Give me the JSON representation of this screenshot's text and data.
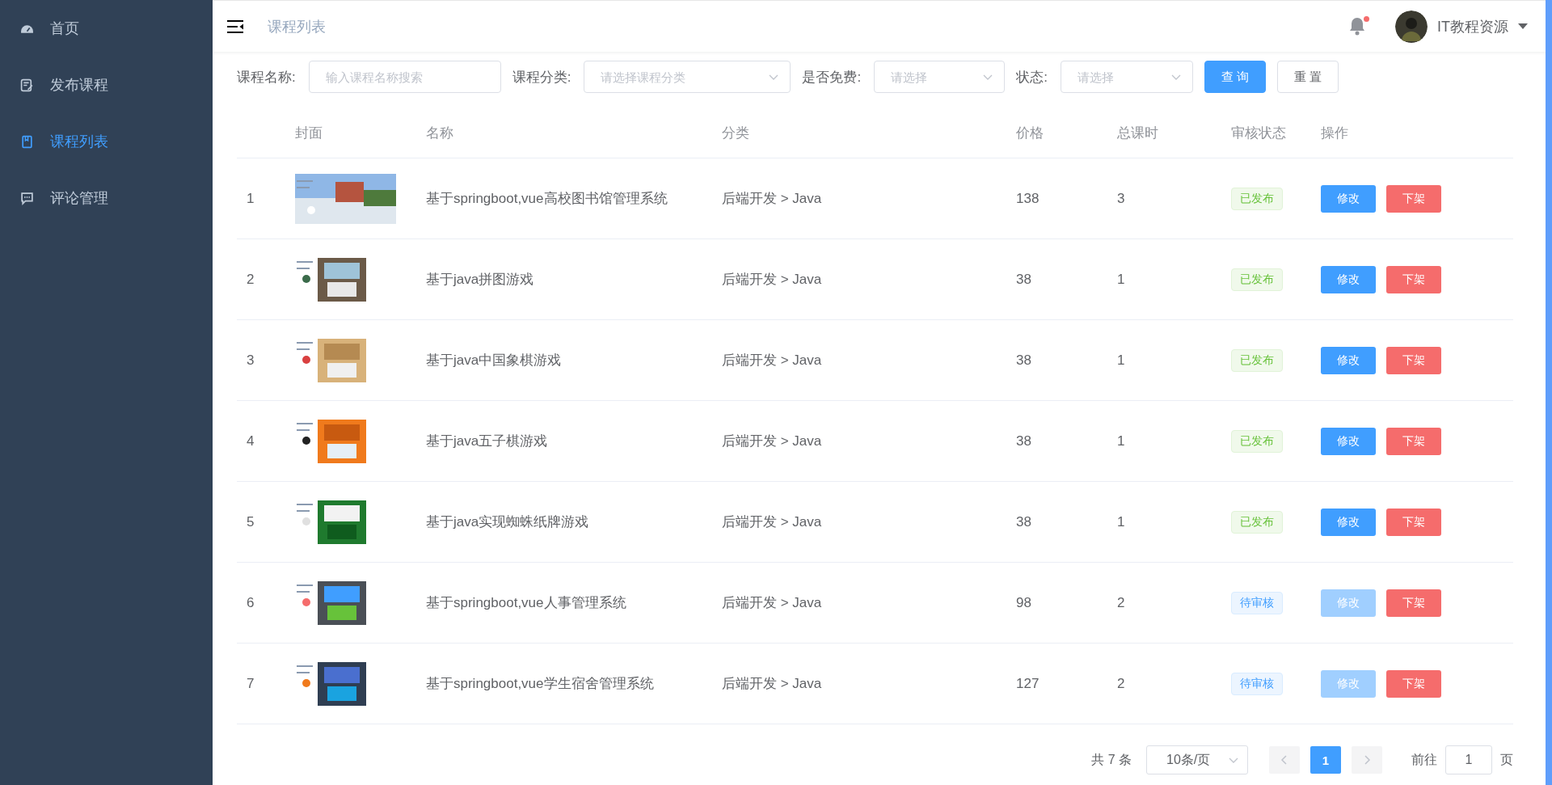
{
  "sidebar": {
    "items": [
      {
        "label": "首页",
        "selected": false
      },
      {
        "label": "发布课程",
        "selected": false
      },
      {
        "label": "课程列表",
        "selected": true
      },
      {
        "label": "评论管理",
        "selected": false
      }
    ]
  },
  "header": {
    "breadcrumb": "课程列表",
    "notification_dot": true,
    "user_name": "IT教程资源"
  },
  "filters": [
    {
      "label": "课程名称:",
      "kind": "input",
      "placeholder": "输入课程名称搜索"
    },
    {
      "label": "课程分类:",
      "kind": "select",
      "placeholder": "请选择课程分类"
    },
    {
      "label": "是否免费:",
      "kind": "select",
      "placeholder": "请选择"
    },
    {
      "label": "状态:",
      "kind": "select",
      "placeholder": "请选择"
    }
  ],
  "filter_buttons": [
    {
      "label": "查 询",
      "kind": "primary"
    },
    {
      "label": "重 置",
      "kind": "plain"
    }
  ],
  "table": {
    "columns": [
      "封面",
      "名称",
      "分类",
      "价格",
      "总课时",
      "审核状态",
      "操作"
    ],
    "rows": [
      {
        "index": "1",
        "name": "基于springboot,vue高校图书馆管理系统",
        "category": "后端开发 > Java",
        "price": "138",
        "hours": "3",
        "status": {
          "text": "已发布",
          "kind": "published"
        },
        "edit": {
          "label": "修改",
          "disabled": false
        },
        "off": {
          "label": "下架"
        }
      },
      {
        "index": "2",
        "name": "基于java拼图游戏",
        "category": "后端开发 > Java",
        "price": "38",
        "hours": "1",
        "status": {
          "text": "已发布",
          "kind": "published"
        },
        "edit": {
          "label": "修改",
          "disabled": false
        },
        "off": {
          "label": "下架"
        }
      },
      {
        "index": "3",
        "name": "基于java中国象棋游戏",
        "category": "后端开发 > Java",
        "price": "38",
        "hours": "1",
        "status": {
          "text": "已发布",
          "kind": "published"
        },
        "edit": {
          "label": "修改",
          "disabled": false
        },
        "off": {
          "label": "下架"
        }
      },
      {
        "index": "4",
        "name": "基于java五子棋游戏",
        "category": "后端开发 > Java",
        "price": "38",
        "hours": "1",
        "status": {
          "text": "已发布",
          "kind": "published"
        },
        "edit": {
          "label": "修改",
          "disabled": false
        },
        "off": {
          "label": "下架"
        }
      },
      {
        "index": "5",
        "name": "基于java实现蜘蛛纸牌游戏",
        "category": "后端开发 > Java",
        "price": "38",
        "hours": "1",
        "status": {
          "text": "已发布",
          "kind": "published"
        },
        "edit": {
          "label": "修改",
          "disabled": false
        },
        "off": {
          "label": "下架"
        }
      },
      {
        "index": "6",
        "name": "基于springboot,vue人事管理系统",
        "category": "后端开发 > Java",
        "price": "98",
        "hours": "2",
        "status": {
          "text": "待审核",
          "kind": "pending"
        },
        "edit": {
          "label": "修改",
          "disabled": true
        },
        "off": {
          "label": "下架"
        }
      },
      {
        "index": "7",
        "name": "基于springboot,vue学生宿舍管理系统",
        "category": "后端开发 > Java",
        "price": "127",
        "hours": "2",
        "status": {
          "text": "待审核",
          "kind": "pending"
        },
        "edit": {
          "label": "修改",
          "disabled": true
        },
        "off": {
          "label": "下架"
        }
      }
    ]
  },
  "pagination": {
    "total": "共 7 条",
    "page_size": "10条/页",
    "pages": [
      {
        "label": "1",
        "selected": true
      }
    ],
    "goto_label": "前往",
    "goto_value": "1",
    "goto_suffix": "页"
  }
}
